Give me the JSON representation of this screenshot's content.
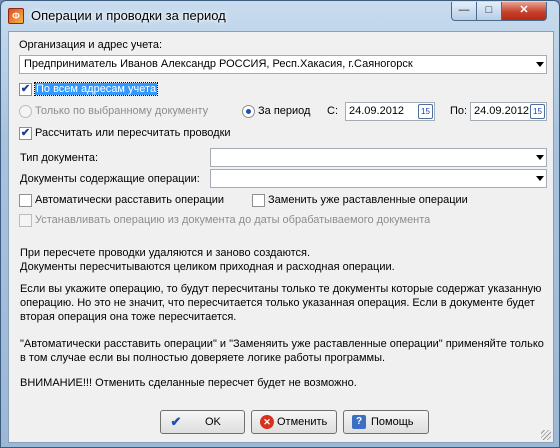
{
  "window": {
    "title": "Операции и проводки за период",
    "app_icon_glyph": "Ф",
    "minimize_glyph": "—",
    "maximize_glyph": "□",
    "close_glyph": "✕"
  },
  "org": {
    "label": "Организация и адрес учета:",
    "value": "Предприниматель Иванов Александр РОССИЯ, Респ.Хакасия, г.Саяногорск"
  },
  "options": {
    "all_addresses": {
      "label": "По всем адресам учета",
      "checked": true,
      "check_glyph": "✔"
    },
    "selected_doc": {
      "label": "Только по выбранному документу",
      "selected": false
    },
    "period": {
      "label": "За период",
      "selected": true
    },
    "from_label": "С:",
    "from_date": "24.09.2012",
    "to_label": "По:",
    "to_date": "24.09.2012",
    "calendar_glyph": "15",
    "recalc": {
      "label": "Рассчитать или пересчитать проводки",
      "checked": true,
      "check_glyph": "✔"
    }
  },
  "filters": {
    "doc_type_label": "Тип документа:",
    "doc_type_value": "",
    "ops_label": "Документы содержащие операции:",
    "ops_value": ""
  },
  "flags": {
    "auto_assign": {
      "label": "Автоматически расставить операции",
      "checked": false
    },
    "replace": {
      "label": "Заменить уже раставленные операции",
      "checked": false
    },
    "set_from_doc": {
      "label": "Устанавливать операцию из документа до даты обрабатываемого документа",
      "checked": false
    }
  },
  "info": {
    "line1": "При пересчете проводки удаляются и заново создаются.",
    "line2": "Документы пересчитываются целиком приходная и расходная операции.",
    "line3": "Если вы укажите операцию, то будут пересчитаны только те документы которые содержат указанную",
    "line4": "операцию. Но это не значит, что пересчитается только указанная операция. Если в документе будет",
    "line5": "вторая операция она тоже пересчитается.",
    "line6": "\"Автоматически расставить операции\" и \"Заменяить уже раставленные операции\" применяйте только",
    "line7": "в том случае если вы полностью доверяете логике работы программы.",
    "line8": "ВНИМАНИЕ!!! Отменить сделанные пересчет будет не возможно."
  },
  "buttons": {
    "ok": {
      "label": "OK",
      "glyph": "✔"
    },
    "cancel": {
      "label": "Отменить",
      "glyph": "✕"
    },
    "help": {
      "label": "Помощь",
      "glyph": "?"
    }
  }
}
